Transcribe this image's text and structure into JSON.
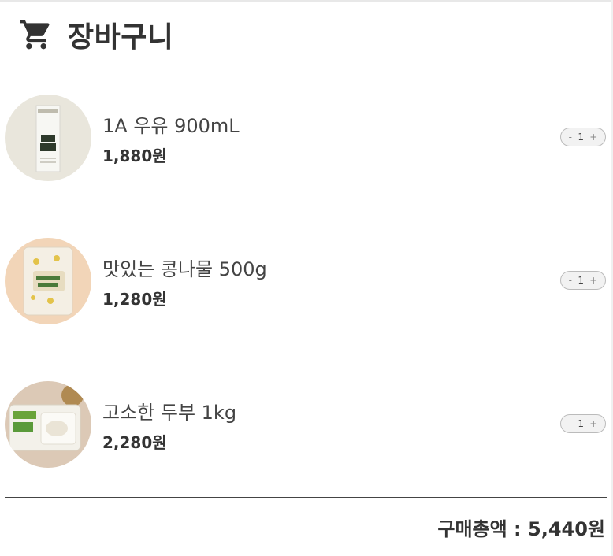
{
  "header": {
    "title": "장바구니",
    "icon": "cart-icon"
  },
  "items": [
    {
      "name": "1A 우유 900mL",
      "price": "1,880원",
      "quantity": "1",
      "minus": "-",
      "plus": "+"
    },
    {
      "name": "맛있는 콩나물 500g",
      "price": "1,280원",
      "quantity": "1",
      "minus": "-",
      "plus": "+"
    },
    {
      "name": "고소한 두부 1kg",
      "price": "2,280원",
      "quantity": "1",
      "minus": "-",
      "plus": "+"
    }
  ],
  "footer": {
    "total": "구매총액 : 5,440원"
  },
  "colors": {
    "text": "#333333",
    "divider": "#444444",
    "stepper_bg": "#f2f2f2"
  }
}
